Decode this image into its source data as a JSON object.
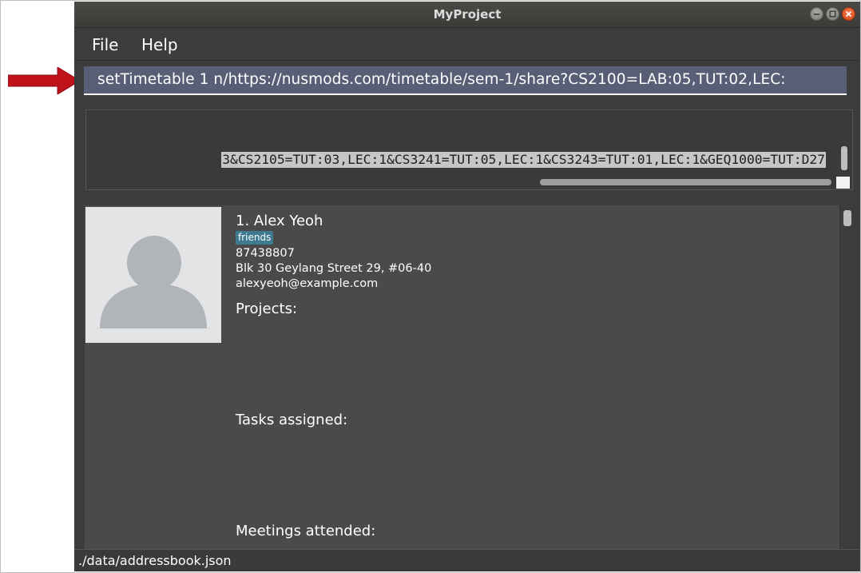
{
  "window": {
    "title": "MyProject"
  },
  "menu": {
    "items": [
      "File",
      "Help"
    ]
  },
  "command_box": {
    "value": "setTimetable 1 n/https://nusmods.com/timetable/sem-1/share?CS2100=LAB:05,TUT:02,LEC:"
  },
  "result_display": {
    "text": "3&CS2105=TUT:03,LEC:1&CS3241=TUT:05,LEC:1&CS3243=TUT:01,LEC:1&GEQ1000=TUT:D27"
  },
  "person_list": [
    {
      "index_name": "1.  Alex Yeoh",
      "tags": [
        "friends"
      ],
      "phone": "87438807",
      "address": "Blk 30 Geylang Street 29, #06-40",
      "email": "alexyeoh@example.com",
      "projects_label": "Projects:",
      "tasks_label": "Tasks assigned:",
      "meetings_label": "Meetings attended:"
    }
  ],
  "status_bar": {
    "path": "./data/addressbook.json"
  },
  "icons": {
    "annotation_arrow": "arrow-right-icon",
    "minimize": "minimize-icon",
    "maximize": "maximize-icon",
    "close": "close-icon",
    "avatar": "user-placeholder-icon"
  },
  "colors": {
    "annotation_arrow": "#c0121b",
    "window_background": "#3c3c3c",
    "command_box": "#585e75",
    "tag": "#3e7b91",
    "close_button": "#e0541f"
  }
}
